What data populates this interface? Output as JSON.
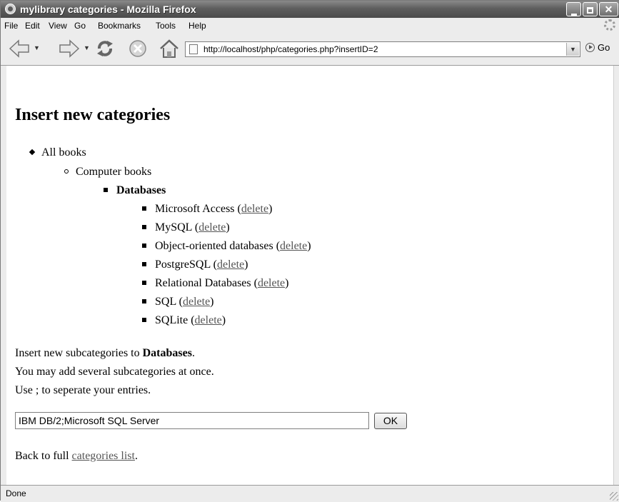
{
  "window": {
    "title": "mylibrary categories - Mozilla Firefox",
    "controls": [
      "minimize",
      "maximize",
      "close"
    ]
  },
  "menu": [
    {
      "label": "File"
    },
    {
      "label": "Edit"
    },
    {
      "label": "View"
    },
    {
      "label": "Go"
    },
    {
      "label": "Bookmarks"
    },
    {
      "label": "Tools"
    },
    {
      "label": "Help"
    }
  ],
  "toolbar": {
    "back_icon": "back-arrow-icon",
    "forward_icon": "forward-arrow-icon",
    "reload_icon": "reload-icon",
    "stop_icon": "stop-icon",
    "home_icon": "home-icon",
    "url": "http://localhost/php/categories.php?insertID=2",
    "go_label": "Go"
  },
  "page": {
    "heading": "Insert new categories",
    "tree": {
      "root": "All books",
      "level1": "Computer books",
      "level2": "Databases",
      "items": [
        {
          "name": "Microsoft Access",
          "link": "delete"
        },
        {
          "name": "MySQL",
          "link": "delete"
        },
        {
          "name": "Object-oriented databases",
          "link": "delete"
        },
        {
          "name": "PostgreSQL",
          "link": "delete"
        },
        {
          "name": "Relational Databases",
          "link": "delete"
        },
        {
          "name": "SQL",
          "link": "delete"
        },
        {
          "name": "SQLite",
          "link": "delete"
        }
      ]
    },
    "instructions": {
      "line1_prefix": "Insert new subcategories to ",
      "line1_bold": "Databases",
      "line1_suffix": ".",
      "line2": "You may add several subcategories at once.",
      "line3": "Use ; to seperate your entries."
    },
    "input_value": "IBM DB/2;Microsoft SQL Server",
    "ok_label": "OK",
    "back": {
      "prefix": "Back to full ",
      "link": "categories list",
      "suffix": "."
    }
  },
  "status": {
    "text": "Done"
  }
}
